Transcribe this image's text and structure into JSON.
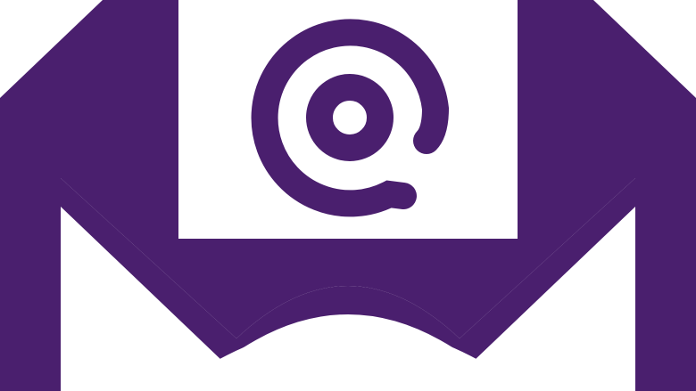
{
  "icon": {
    "name": "email-envelope-at-icon",
    "parts": [
      "envelope-icon",
      "letter-sheet",
      "at-sign-icon"
    ]
  },
  "colors": {
    "brand": "#4a1f6e",
    "background": "#ffffff"
  }
}
